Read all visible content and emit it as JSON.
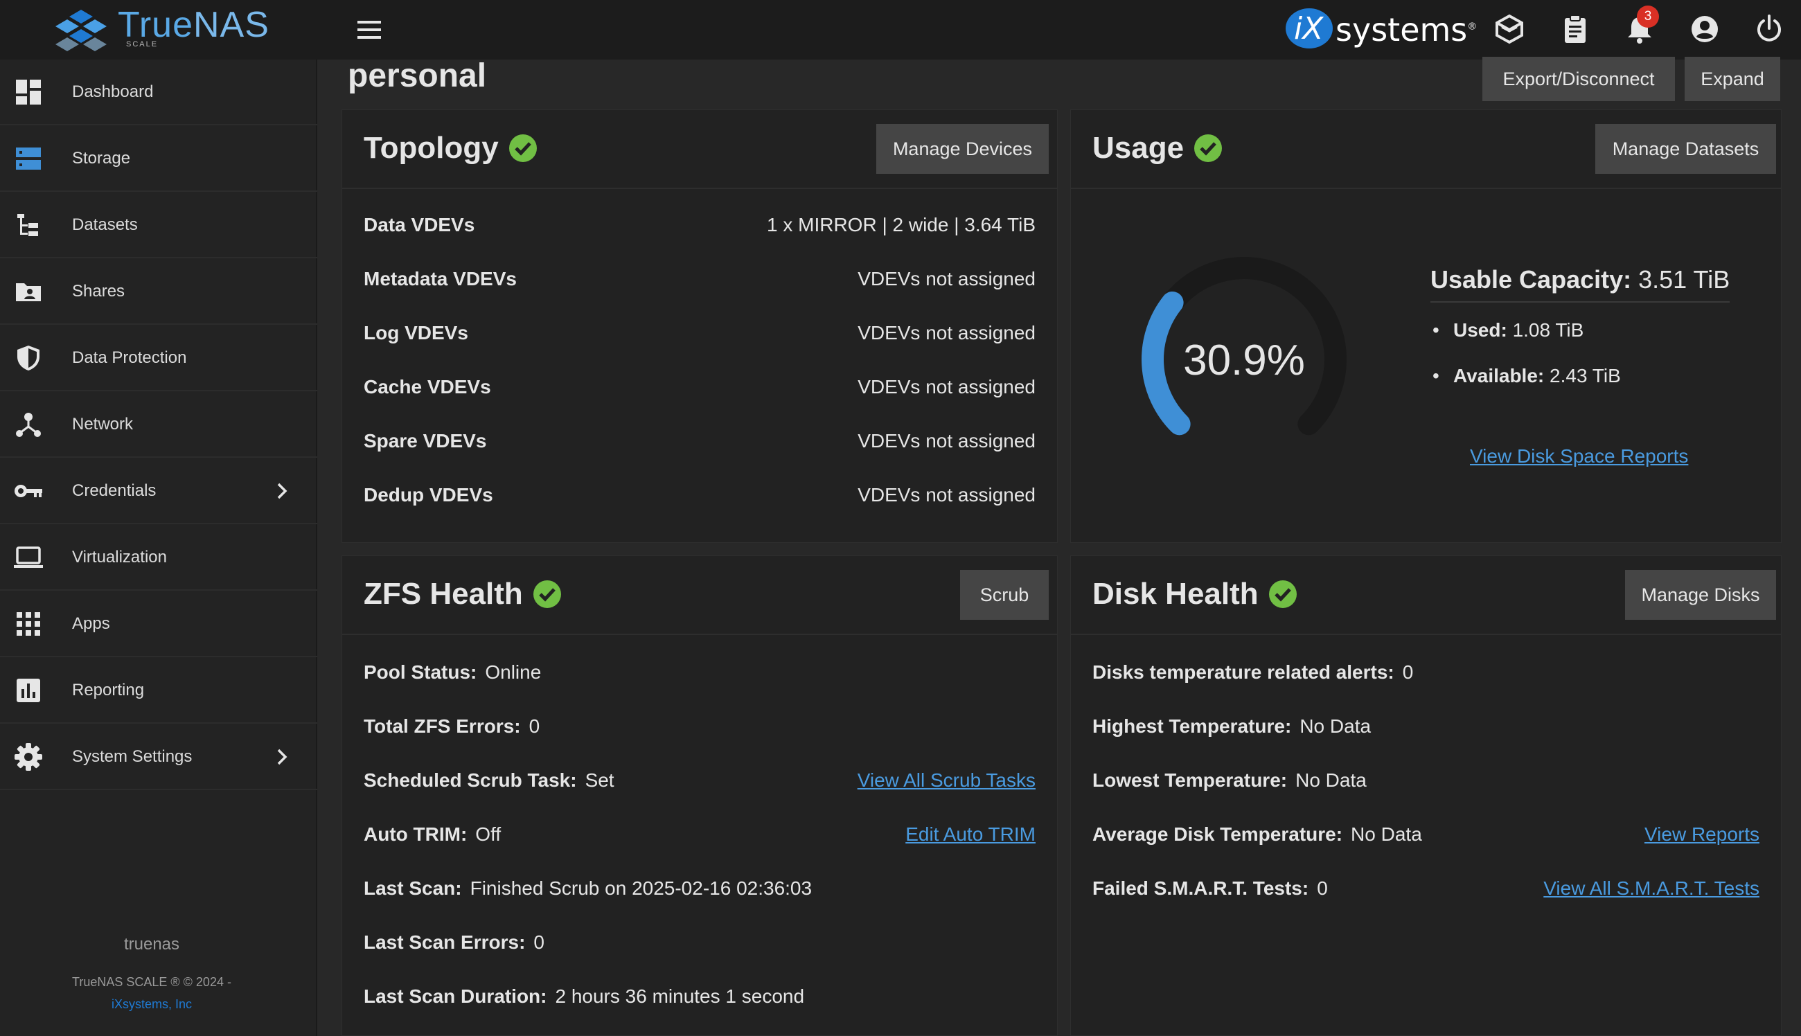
{
  "brand": {
    "name_a": "True",
    "name_b": "NAS",
    "sub": "SCALE"
  },
  "vendor": {
    "ix": "iX",
    "systems": "systems"
  },
  "notifications": {
    "count": "3"
  },
  "sidebar": {
    "items": [
      {
        "label": "Dashboard",
        "icon": "dashboard-icon"
      },
      {
        "label": "Storage",
        "icon": "storage-icon"
      },
      {
        "label": "Datasets",
        "icon": "datasets-icon"
      },
      {
        "label": "Shares",
        "icon": "shares-icon"
      },
      {
        "label": "Data Protection",
        "icon": "shield-icon"
      },
      {
        "label": "Network",
        "icon": "network-icon"
      },
      {
        "label": "Credentials",
        "icon": "key-icon"
      },
      {
        "label": "Virtualization",
        "icon": "laptop-icon"
      },
      {
        "label": "Apps",
        "icon": "apps-grid-icon"
      },
      {
        "label": "Reporting",
        "icon": "reporting-icon"
      },
      {
        "label": "System Settings",
        "icon": "gear-icon"
      }
    ],
    "hostname": "truenas",
    "copyright": "TrueNAS SCALE ® © 2024 -",
    "company": "iXsystems, Inc"
  },
  "page": {
    "title": "personal",
    "export_label": "Export/Disconnect",
    "expand_label": "Expand"
  },
  "topology": {
    "title": "Topology",
    "button": "Manage Devices",
    "rows": [
      {
        "k": "Data VDEVs",
        "v": "1 x MIRROR | 2 wide | 3.64 TiB"
      },
      {
        "k": "Metadata VDEVs",
        "v": "VDEVs not assigned"
      },
      {
        "k": "Log VDEVs",
        "v": "VDEVs not assigned"
      },
      {
        "k": "Cache VDEVs",
        "v": "VDEVs not assigned"
      },
      {
        "k": "Spare VDEVs",
        "v": "VDEVs not assigned"
      },
      {
        "k": "Dedup VDEVs",
        "v": "VDEVs not assigned"
      }
    ]
  },
  "usage": {
    "title": "Usage",
    "button": "Manage Datasets",
    "percent_label": "30.9%",
    "percent_value": 30.9,
    "usable_label": "Usable Capacity:",
    "usable_value": "3.51 TiB",
    "used_label": "Used:",
    "used_value": "1.08 TiB",
    "available_label": "Available:",
    "available_value": "2.43 TiB",
    "link": "View Disk Space Reports",
    "accent": "#3f8fd6"
  },
  "zfs": {
    "title": "ZFS Health",
    "button": "Scrub",
    "pool_status_k": "Pool Status:",
    "pool_status_v": "Online",
    "errors_k": "Total ZFS Errors:",
    "errors_v": "0",
    "scrub_task_k": "Scheduled Scrub Task:",
    "scrub_task_v": "Set",
    "scrub_task_link": "View All Scrub Tasks",
    "trim_k": "Auto TRIM:",
    "trim_v": "Off",
    "trim_link": "Edit Auto TRIM",
    "last_scan_k": "Last Scan:",
    "last_scan_v": "Finished Scrub on 2025-02-16 02:36:03",
    "scan_errors_k": "Last Scan Errors:",
    "scan_errors_v": "0",
    "scan_duration_k": "Last Scan Duration:",
    "scan_duration_v": "2 hours 36 minutes 1 second"
  },
  "disk": {
    "title": "Disk Health",
    "button": "Manage Disks",
    "temp_alerts_k": "Disks temperature related alerts:",
    "temp_alerts_v": "0",
    "highest_k": "Highest Temperature:",
    "highest_v": "No Data",
    "lowest_k": "Lowest Temperature:",
    "lowest_v": "No Data",
    "avg_k": "Average Disk Temperature:",
    "avg_v": "No Data",
    "avg_link": "View Reports",
    "smart_k": "Failed S.M.A.R.T. Tests:",
    "smart_v": "0",
    "smart_link": "View All S.M.A.R.T. Tests"
  },
  "colors": {
    "healthy": "#71bf44",
    "link": "#4a9be0",
    "brand": "#1f7ad3"
  }
}
